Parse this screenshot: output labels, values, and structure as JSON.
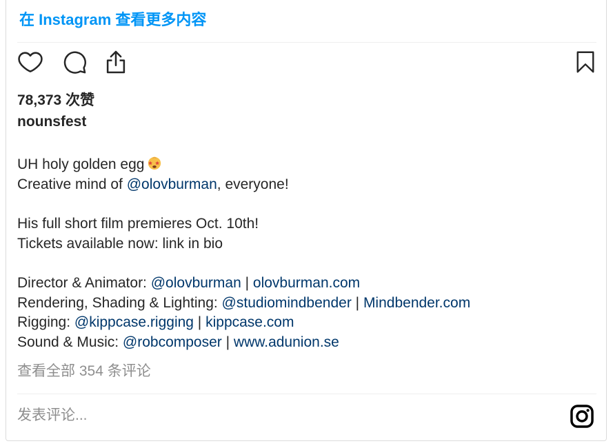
{
  "header": {
    "view_more_link": "在 Instagram 查看更多内容"
  },
  "actions": {
    "like_icon": "heart-icon",
    "comment_icon": "comment-icon",
    "share_icon": "share-icon",
    "save_icon": "bookmark-icon"
  },
  "post": {
    "likes": "78,373 次赞",
    "username": "nounsfest",
    "caption": {
      "line1_text": "UH holy golden egg",
      "line1_emoji": "star-struck-emoji",
      "line2_prefix": "Creative mind of ",
      "line2_mention": "@olovburman",
      "line2_suffix": ", everyone!",
      "line3": "His full short film premieres Oct. 10th!",
      "line4": "Tickets available now: link in bio",
      "credits": [
        {
          "label": "Director & Animator: ",
          "mention": "@olovburman",
          "sep": " | ",
          "link": "olovburman.com"
        },
        {
          "label": "Rendering, Shading & Lighting: ",
          "mention": "@studiomindbender",
          "sep": " | ",
          "link": "Mindbender.com"
        },
        {
          "label": "Rigging: ",
          "mention": "@kippcase.rigging",
          "sep": " | ",
          "link": "kippcase.com"
        },
        {
          "label": "Sound & Music: ",
          "mention": "@robcomposer",
          "sep": " | ",
          "link": "www.adunion.se"
        }
      ]
    },
    "view_comments": "查看全部 354 条评论"
  },
  "comment_box": {
    "placeholder": "发表评论...",
    "value": "",
    "logo_icon": "instagram-logo-icon"
  },
  "colors": {
    "link_blue": "#0095f6",
    "mention_blue": "#00376b",
    "text": "#262626",
    "muted": "#8e8e8e",
    "border": "#dbdbdb"
  }
}
